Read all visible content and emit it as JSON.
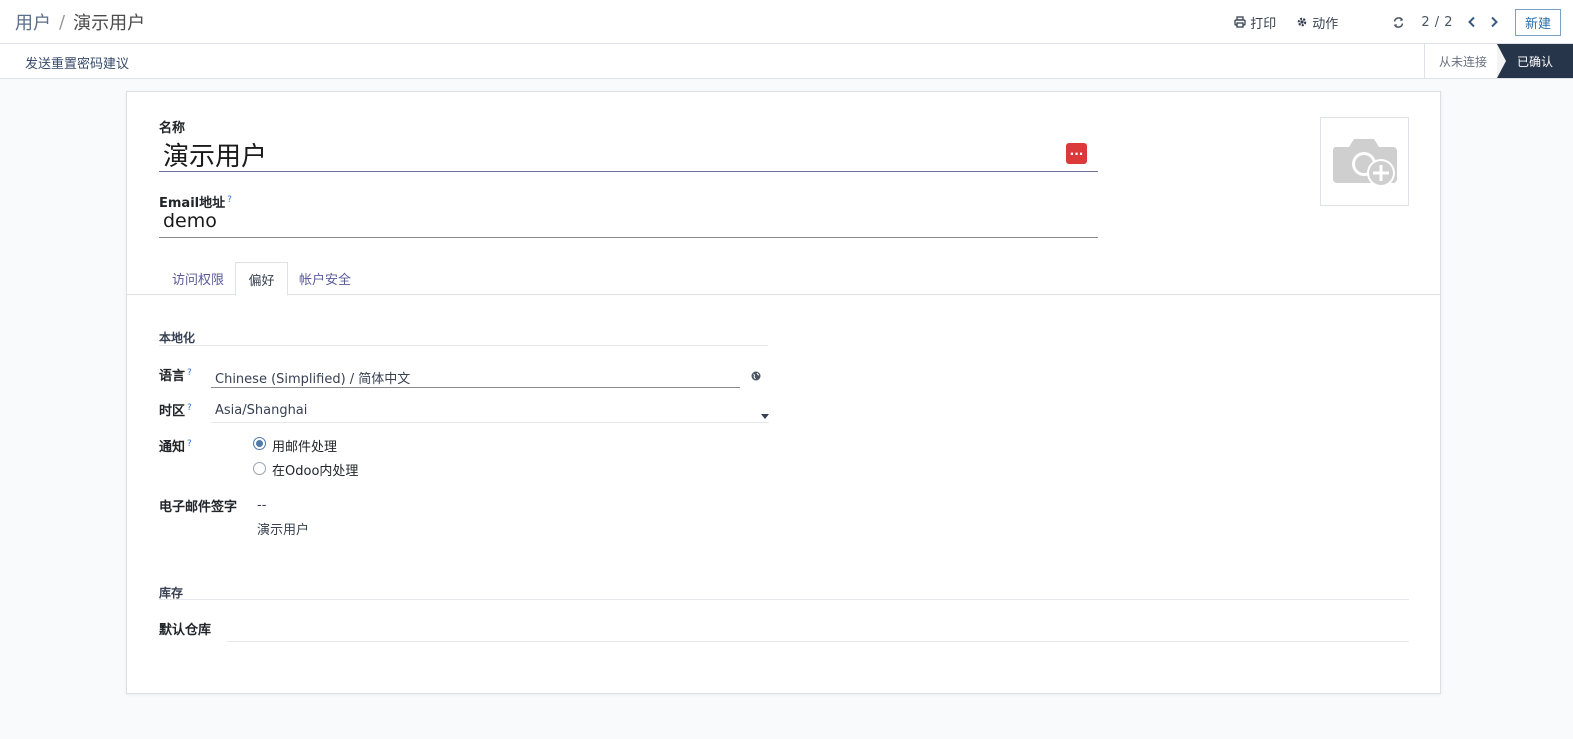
{
  "breadcrumb": {
    "parent": "用户",
    "separator": "/",
    "current": "演示用户"
  },
  "actions": {
    "print": "打印",
    "action": "动作"
  },
  "pager": {
    "value": "2 / 2"
  },
  "new_button": "新建",
  "statusbar": {
    "button": "发送重置密码建议",
    "steps": [
      {
        "label": "从未连接",
        "active": false
      },
      {
        "label": "已确认",
        "active": true
      }
    ]
  },
  "form": {
    "name_label": "名称",
    "name_value": "演示用户",
    "email_label": "Email地址",
    "email_value": "demo",
    "help_mark": "?"
  },
  "tabs": [
    {
      "label": "访问权限",
      "active": false
    },
    {
      "label": "偏好",
      "active": true
    },
    {
      "label": "帐户安全",
      "active": false
    }
  ],
  "localization": {
    "title": "本地化",
    "language_label": "语言",
    "language_value": "Chinese (Simplified) / 简体中文",
    "timezone_label": "时区",
    "timezone_value": "Asia/Shanghai",
    "notification_label": "通知",
    "notification_options": [
      {
        "label": "用邮件处理",
        "checked": true
      },
      {
        "label": "在Odoo内处理",
        "checked": false
      }
    ],
    "signature_label": "电子邮件签字",
    "signature_line1": "--",
    "signature_line2": "演示用户"
  },
  "inventory": {
    "title": "库存",
    "warehouse_label": "默认仓库",
    "warehouse_value": ""
  },
  "colors": {
    "accent": "#2c6fad",
    "status_active": "#27354a",
    "ellipsis_red": "#dc3a3a",
    "radio_checked": "#4f7aa8"
  },
  "icons": {
    "print": "print-icon",
    "action": "gear-icon",
    "refresh": "refresh-icon",
    "prev": "chevron-left-icon",
    "next": "chevron-right-icon",
    "globe": "globe-icon",
    "caret": "caret-down-icon",
    "avatar": "camera-plus-icon"
  }
}
